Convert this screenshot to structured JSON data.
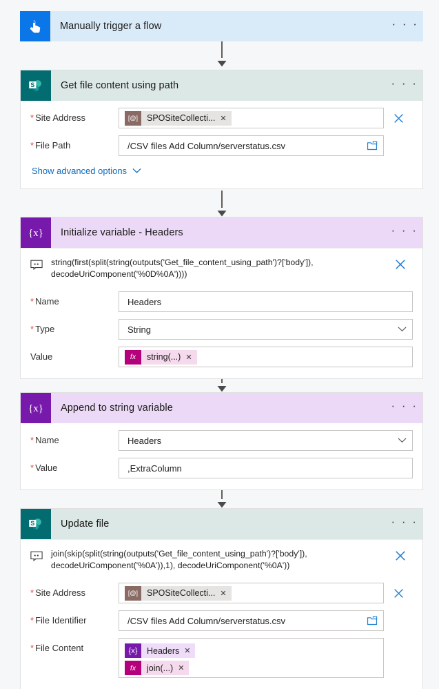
{
  "flow": {
    "steps": [
      {
        "id": "trigger",
        "icon": "manual-trigger-icon",
        "title": "Manually trigger a flow",
        "menu": "· · ·"
      },
      {
        "id": "get-file-content",
        "icon": "sharepoint-icon",
        "title": "Get file content using path",
        "menu": "· · ·",
        "fields": [
          {
            "label": "Site Address",
            "required": true,
            "control": "token",
            "token": {
              "kind": "dynamic",
              "icon_text": "[@]",
              "text": "SPOSiteCollecti...",
              "remove": "✕"
            },
            "trailing": "clear-x"
          },
          {
            "label": "File Path",
            "required": true,
            "control": "text",
            "value": "/CSV files Add Column/serverstatus.csv",
            "trailing": "folder-picker"
          }
        ],
        "advanced_label": "Show advanced options"
      },
      {
        "id": "initialize-variable",
        "icon": "variable-icon",
        "title": "Initialize variable - Headers",
        "menu": "· · ·",
        "expression": "string(first(split(string(outputs('Get_file_content_using_path')?['body']), decodeUriComponent('%0D%0A'))))",
        "fields": [
          {
            "label": "Name",
            "required": true,
            "control": "text",
            "value": "Headers"
          },
          {
            "label": "Type",
            "required": true,
            "control": "select",
            "value": "String"
          },
          {
            "label": "Value",
            "required": false,
            "control": "token",
            "token": {
              "kind": "fx",
              "icon_text": "fx",
              "text": "string(...)",
              "remove": "✕"
            }
          }
        ]
      },
      {
        "id": "append-to-string-variable",
        "icon": "variable-icon",
        "title": "Append to string variable",
        "menu": "· · ·",
        "fields": [
          {
            "label": "Name",
            "required": true,
            "control": "select",
            "value": "Headers"
          },
          {
            "label": "Value",
            "required": true,
            "control": "text",
            "value": ",ExtraColumn"
          }
        ]
      },
      {
        "id": "update-file",
        "icon": "sharepoint-icon",
        "title": "Update file",
        "menu": "· · ·",
        "expression": "join(skip(split(string(outputs('Get_file_content_using_path')?['body']), decodeUriComponent('%0A')),1), decodeUriComponent('%0A'))",
        "fields": [
          {
            "label": "Site Address",
            "required": true,
            "control": "token",
            "token": {
              "kind": "dynamic",
              "icon_text": "[@]",
              "text": "SPOSiteCollecti...",
              "remove": "✕"
            },
            "trailing": "clear-x"
          },
          {
            "label": "File Identifier",
            "required": true,
            "control": "text",
            "value": "/CSV files Add Column/serverstatus.csv",
            "trailing": "folder-picker"
          },
          {
            "label": "File Content",
            "required": true,
            "control": "token-list",
            "tokens": [
              {
                "kind": "variable",
                "icon_text": "{x}",
                "text": "Headers",
                "remove": "✕"
              },
              {
                "kind": "fx",
                "icon_text": "fx",
                "text": "join(...)",
                "remove": "✕"
              }
            ]
          }
        ]
      }
    ]
  },
  "colors": {
    "trigger_header": "#d9eaf9",
    "trigger_icon": "#0b76e8",
    "sharepoint_header": "#dbe8e5",
    "sharepoint_icon": "#036c70",
    "variable_header": "#ecd9f7",
    "variable_icon": "#7719aa",
    "required_asterisk": "#e8484e",
    "link": "#0f6cbd",
    "canvas_background": "#f6f7f8",
    "chip_dynamic_icon": "#8a6b64",
    "chip_fx_icon": "#b5007c"
  }
}
